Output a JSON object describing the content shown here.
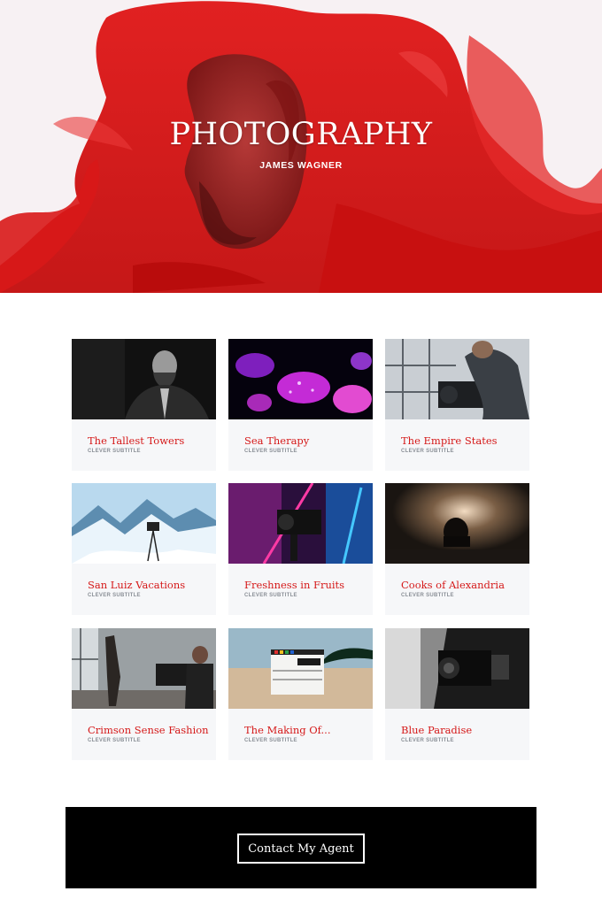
{
  "hero": {
    "title": "PHOTOGRAPHY",
    "subtitle": "JAMES WAGNER"
  },
  "cards": [
    {
      "title": "The Tallest Towers",
      "subtitle": "CLEVER SUBTITLE"
    },
    {
      "title": "Sea Therapy",
      "subtitle": "CLEVER SUBTITLE"
    },
    {
      "title": "The Empire States",
      "subtitle": "CLEVER SUBTITLE"
    },
    {
      "title": "San Luiz Vacations",
      "subtitle": "CLEVER SUBTITLE"
    },
    {
      "title": "Freshness in Fruits",
      "subtitle": "CLEVER SUBTITLE"
    },
    {
      "title": "Cooks of Alexandria",
      "subtitle": "CLEVER SUBTITLE"
    },
    {
      "title": "Crimson Sense Fashion",
      "subtitle": "CLEVER SUBTITLE"
    },
    {
      "title": "The Making Of...",
      "subtitle": "CLEVER SUBTITLE"
    },
    {
      "title": "Blue Paradise",
      "subtitle": "CLEVER SUBTITLE"
    }
  ],
  "cta": {
    "button_label": "Contact My Agent"
  },
  "colors": {
    "accent": "#d51919",
    "ink": "#d10d0d",
    "card_bg": "#f6f7f9",
    "footer_bg": "#000000"
  }
}
